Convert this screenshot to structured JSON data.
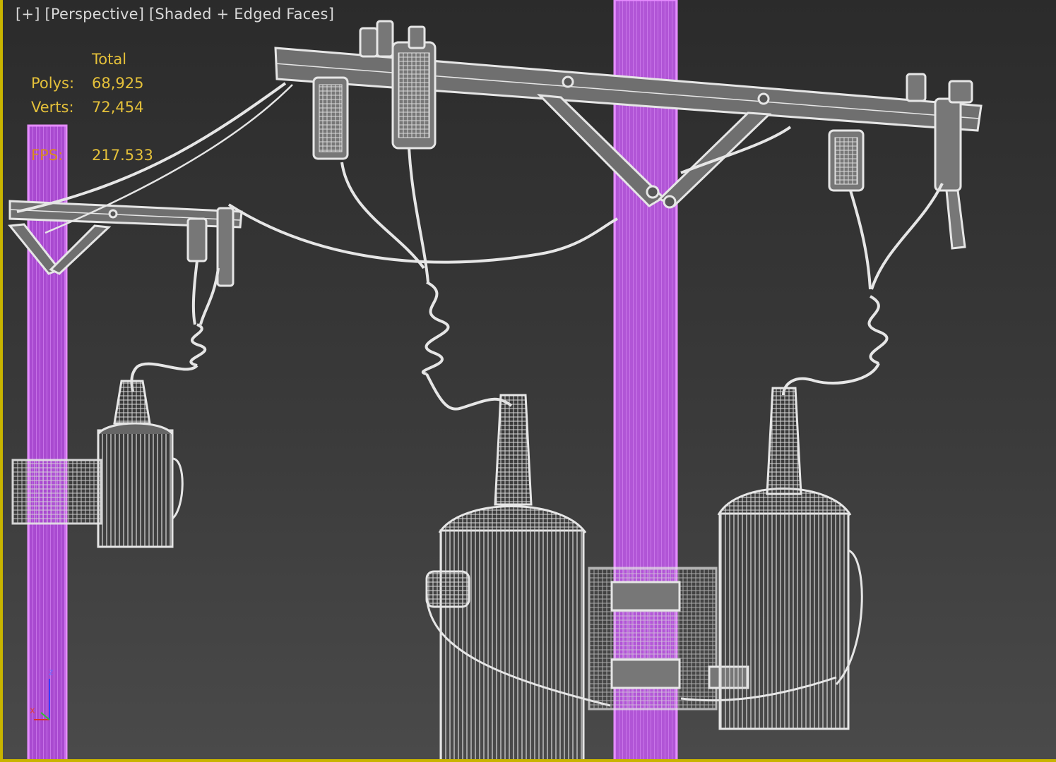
{
  "viewport": {
    "label": {
      "plus": "[+]",
      "view": "[Perspective]",
      "shading": "[Shaded + Edged Faces]"
    },
    "stats": {
      "header": "Total",
      "polys_label": "Polys:",
      "polys_value": "68,925",
      "verts_label": "Verts:",
      "verts_value": "72,454",
      "fps_label": "FPS:",
      "fps_value": "217.533"
    },
    "axis": {
      "z": "z",
      "x": "x"
    },
    "colors": {
      "selected_pole": "#c060e0",
      "wireframe": "#e6e6e6",
      "stats_text": "#e5c13a",
      "fps_label": "#d98c1a",
      "active_border": "#c8b400"
    }
  }
}
